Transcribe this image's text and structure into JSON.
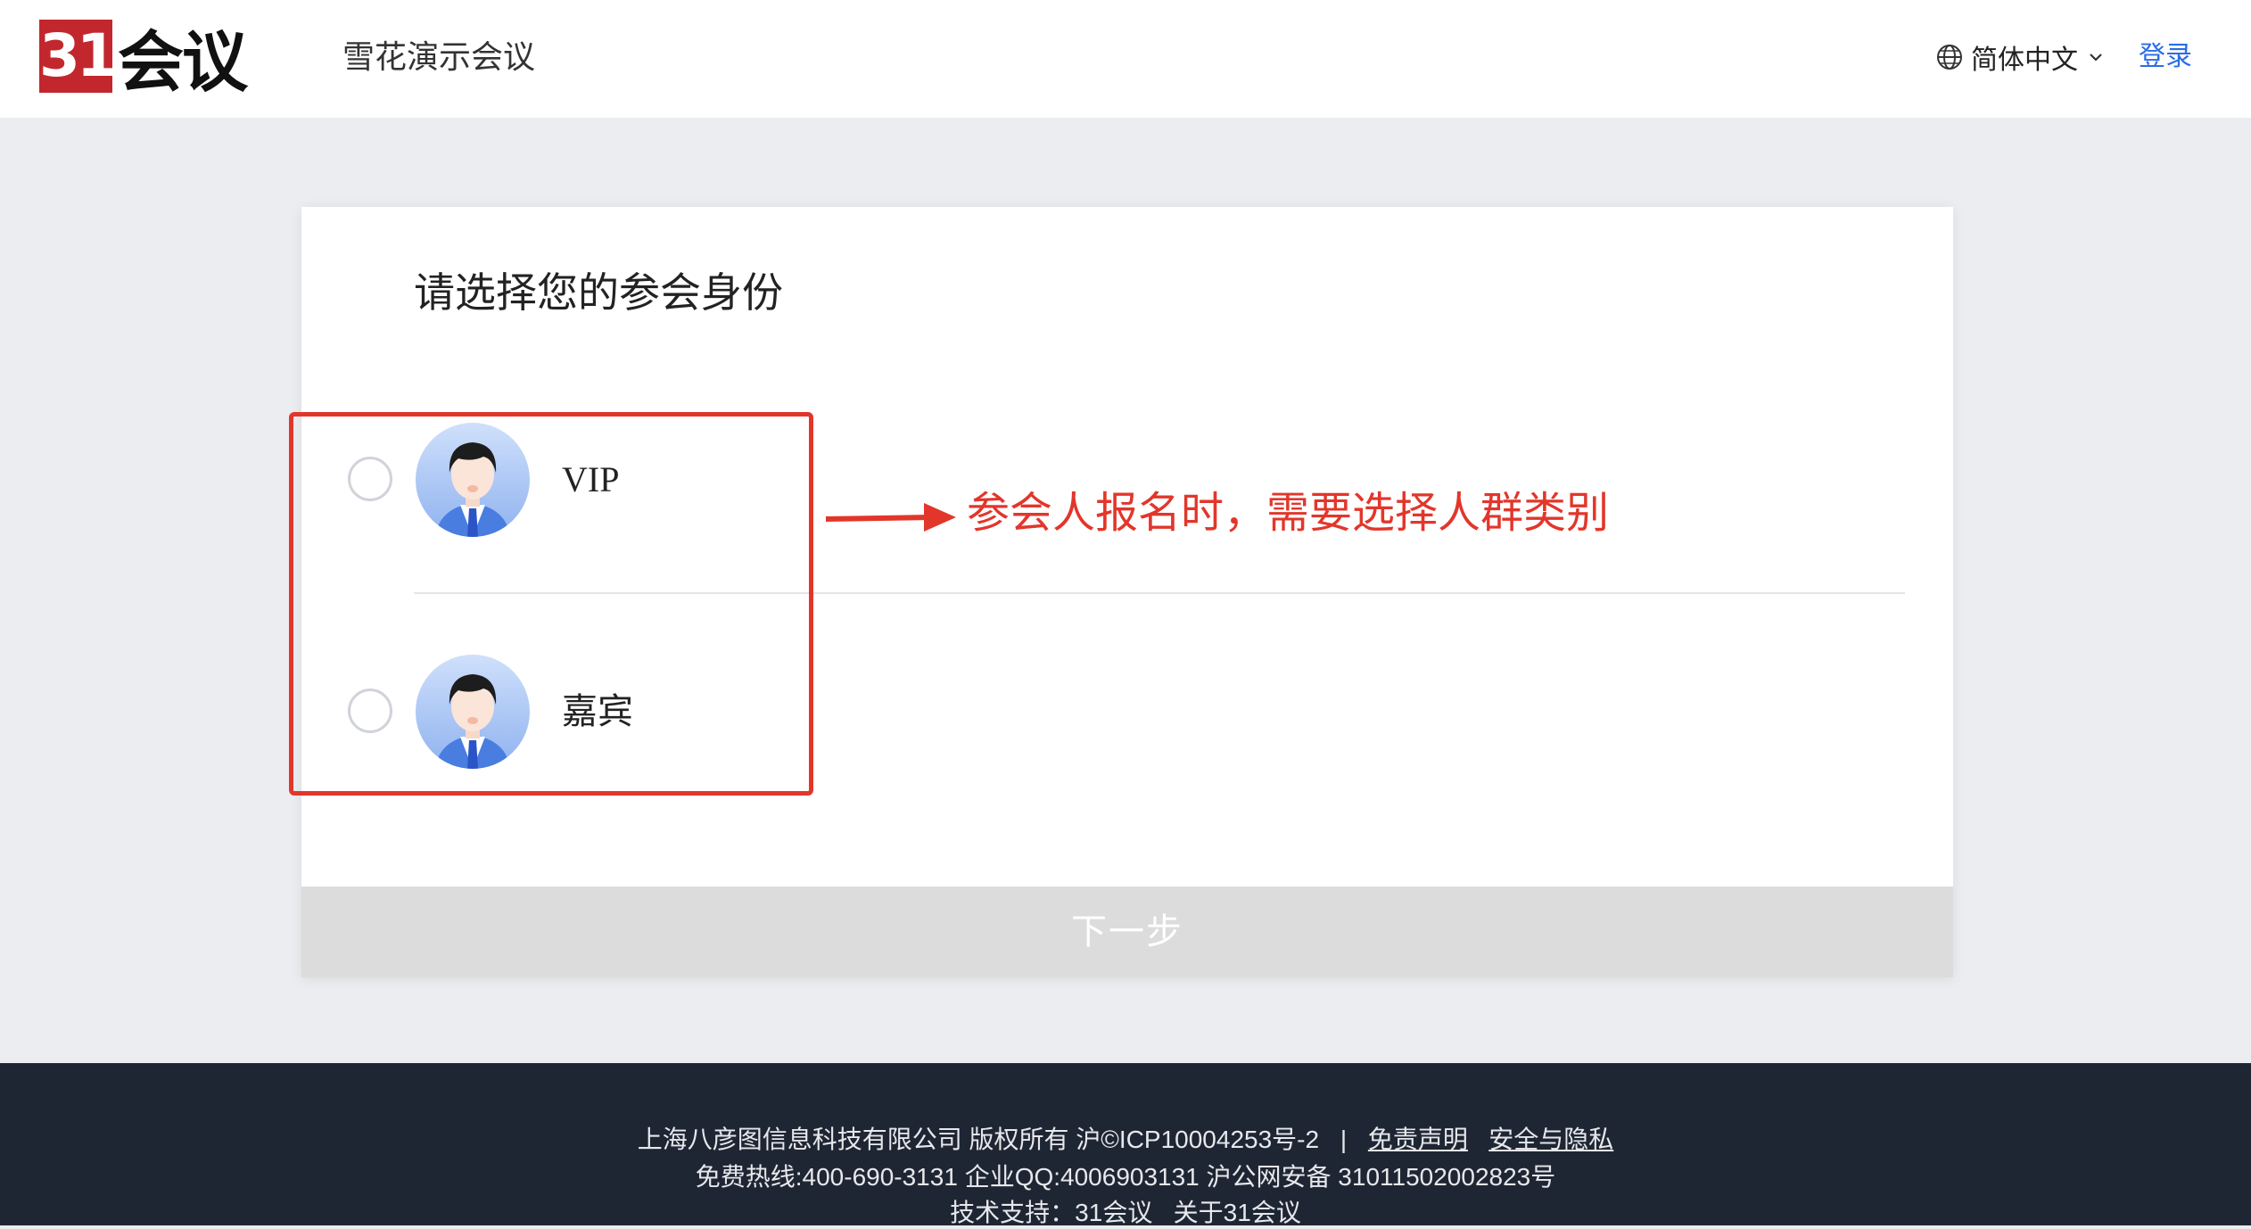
{
  "header": {
    "logo_mark": "31",
    "logo_text": "会议",
    "site_title": "雪花演示会议",
    "language_label": "简体中文",
    "login_label": "登录"
  },
  "card": {
    "title": "请选择您的参会身份",
    "options": [
      {
        "label": "VIP",
        "selected": false
      },
      {
        "label": "嘉宾",
        "selected": false
      }
    ],
    "next_label": "下一步"
  },
  "annotation": {
    "text": "参会人报名时，需要选择人群类别",
    "color": "#e2362b"
  },
  "footer": {
    "company": "上海八彦图信息科技有限公司 版权所有 沪©ICP10004253号-2",
    "separator": "|",
    "disclaimer": "免责声明",
    "privacy": "安全与隐私",
    "hotline": "免费热线:400-690-3131",
    "qq": "企业QQ:4006903131",
    "police": "沪公网安备 31011502002823号",
    "support": "技术支持：31会议",
    "about": "关于31会议"
  },
  "colors": {
    "brand_red": "#c2272d",
    "link_blue": "#2b6de5",
    "footer_bg": "#1f2633",
    "button_disabled": "#dcdcdc"
  }
}
